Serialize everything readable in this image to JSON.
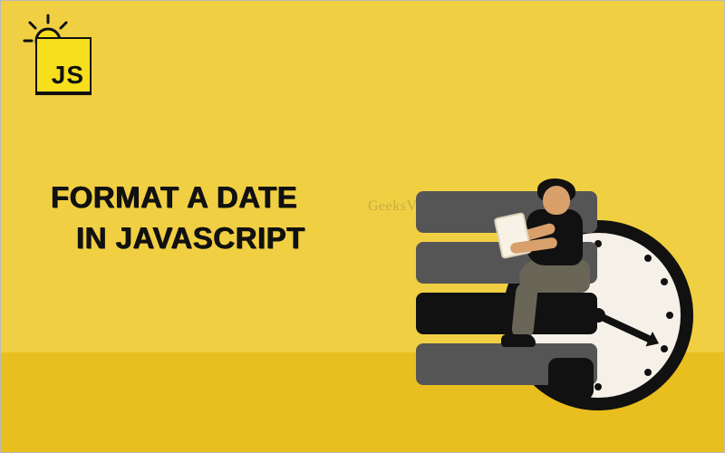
{
  "badge": {
    "label": "JS"
  },
  "headline": {
    "line1": "Format a Date",
    "line2": "in JavaScript"
  },
  "watermark": "GeeksVeda",
  "colors": {
    "background": "#f1cf43",
    "floor": "#e9be1f",
    "js_badge": "#f7df1e",
    "ink": "#111111",
    "server_light": "#555555",
    "clock_face": "#f5f1e8",
    "skin": "#d9a06b",
    "pants": "#6a6657",
    "tablet": "#f7f2e6"
  },
  "icons": {
    "lightbulb": "lightbulb-idea-icon",
    "clock": "analog-clock-icon",
    "server": "server-stack-icon",
    "person": "person-reading-tablet"
  },
  "clock": {
    "hour_marks": 12,
    "hand_angle_deg": 25
  }
}
